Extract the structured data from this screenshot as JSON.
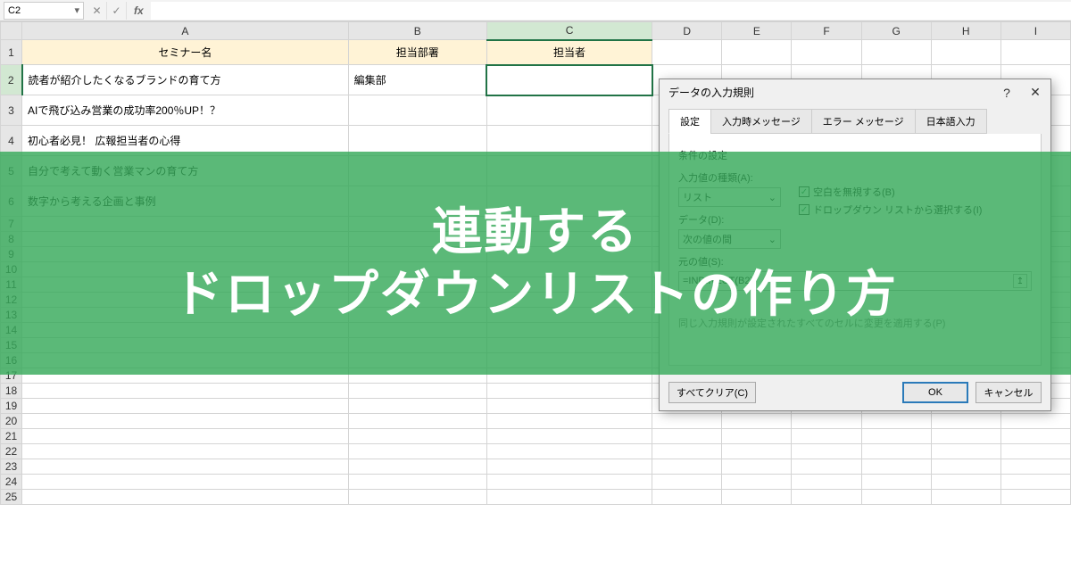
{
  "formula_bar": {
    "name_box": "C2"
  },
  "columns": [
    "A",
    "B",
    "C",
    "D",
    "E",
    "F",
    "G",
    "H",
    "I"
  ],
  "headers": {
    "a": "セミナー名",
    "b": "担当部署",
    "c": "担当者"
  },
  "rows": [
    {
      "n": "2",
      "a": "読者が紹介したくなるブランドの育て方",
      "b": "編集部",
      "c": ""
    },
    {
      "n": "3",
      "a": "AIで飛び込み営業の成功率200％UP！？",
      "b": "",
      "c": ""
    },
    {
      "n": "4",
      "a": "初心者必見！ 広報担当者の心得",
      "b": "",
      "c": ""
    },
    {
      "n": "5",
      "a": "自分で考えて動く営業マンの育て方",
      "b": "",
      "c": ""
    },
    {
      "n": "6",
      "a": "数字から考える企画と事例",
      "b": "",
      "c": ""
    }
  ],
  "empty_rows": [
    "7",
    "8",
    "9",
    "10",
    "11",
    "12",
    "13",
    "14",
    "15",
    "16",
    "17",
    "18",
    "19",
    "20",
    "21",
    "22",
    "23",
    "24",
    "25"
  ],
  "dialog": {
    "title": "データの入力規則",
    "help": "?",
    "close": "✕",
    "tabs": {
      "t1": "設定",
      "t2": "入力時メッセージ",
      "t3": "エラー メッセージ",
      "t4": "日本語入力"
    },
    "section": "条件の設定",
    "allow_label": "入力値の種類(A):",
    "allow_value": "リスト",
    "ignore_blank": "空白を無視する(B)",
    "in_cell_dropdown": "ドロップダウン リストから選択する(I)",
    "data_label": "データ(D):",
    "data_value": "次の値の間",
    "source_label": "元の値(S):",
    "source_value": "=INDIRECT(B2)",
    "apply_note": "同じ入力規則が設定されたすべてのセルに変更を適用する(P)",
    "clear": "すべてクリア(C)",
    "ok": "OK",
    "cancel": "キャンセル"
  },
  "overlay": {
    "line1": "連動する",
    "line2": "ドロップダウンリストの作り方"
  }
}
